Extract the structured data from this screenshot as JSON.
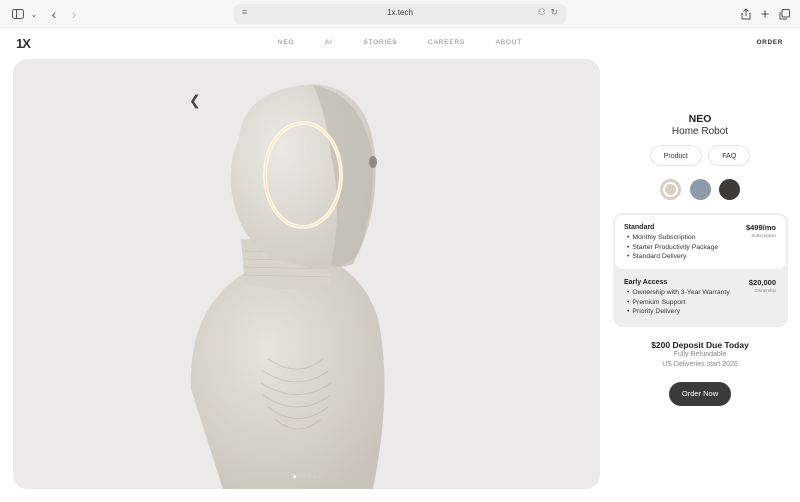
{
  "browser": {
    "url": "1x.tech"
  },
  "nav": {
    "logo": "1X",
    "links": [
      "NEO",
      "AI",
      "STORIES",
      "CAREERS",
      "ABOUT"
    ],
    "order": "ORDER"
  },
  "hero": {
    "slide_count": 6,
    "active_slide": 1
  },
  "product": {
    "name": "NEO",
    "subtitle": "Home Robot",
    "tabs": [
      "Product",
      "FAQ"
    ],
    "swatch_colors": [
      "#d8cec3",
      "#8d9aa7",
      "#3e3a35"
    ],
    "selected_swatch": 0
  },
  "plans": {
    "standard": {
      "title": "Standard",
      "price": "$499/mo",
      "note": "Subscription",
      "features": [
        "Monthly Subscription",
        "Starter Productivity Package",
        "Standard Delivery"
      ]
    },
    "early_access": {
      "title": "Early Access",
      "price": "$20,000",
      "note": "Ownership",
      "features": [
        "Ownership with 3-Year Warranty",
        "Premium Support",
        "Priority Delivery"
      ]
    }
  },
  "checkout": {
    "deposit": "$200 Deposit Due Today",
    "refund": "Fully Refundable",
    "delivery": "US Deliveries start 2026",
    "button": "Order Now"
  }
}
